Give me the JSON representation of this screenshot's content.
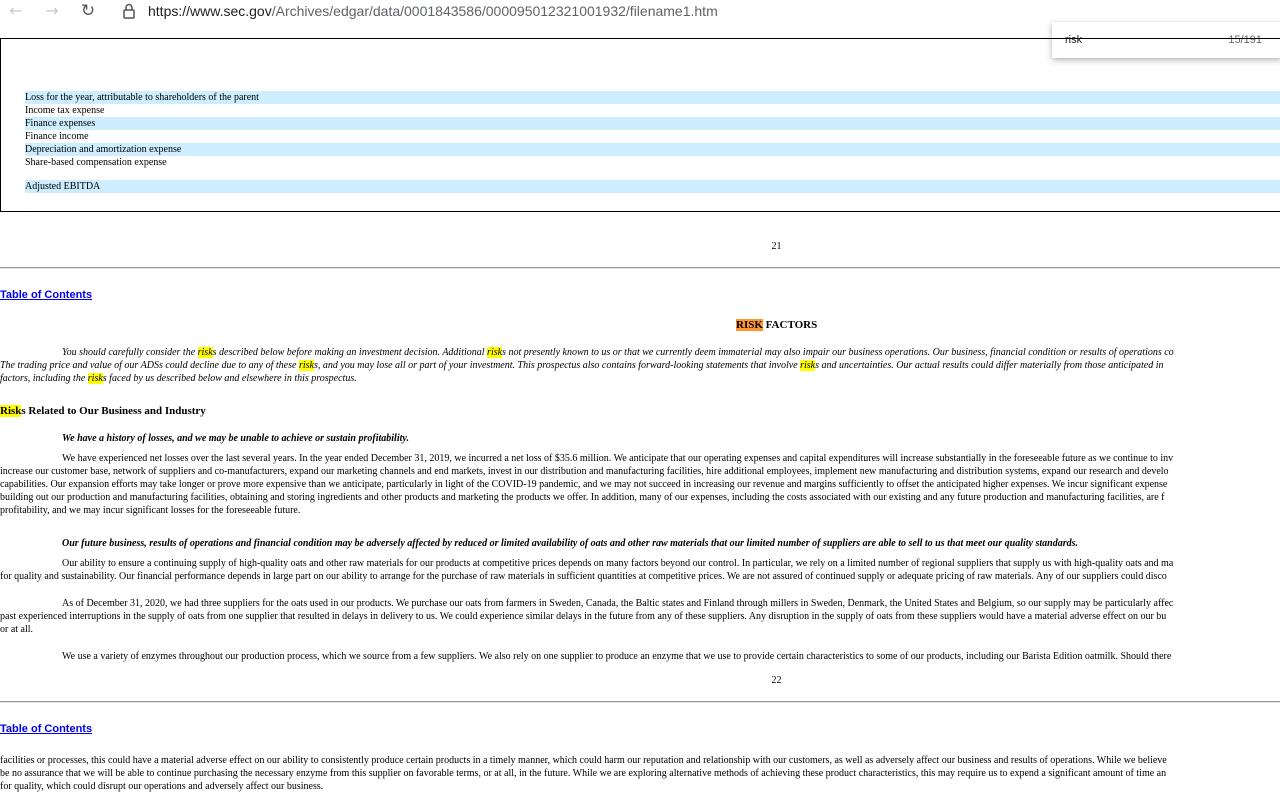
{
  "browser": {
    "url_host": "https://www.sec.gov",
    "url_path": "/Archives/edgar/data/0001843586/000095012321001932/filename1.htm",
    "icons": [
      "back-arrow-icon",
      "forward-arrow-icon",
      "reload-icon",
      "lock-icon"
    ]
  },
  "find": {
    "query": "risk",
    "count": "15/191"
  },
  "table_rows": [
    "Loss for the year, attributable to shareholders of the parent",
    "Income tax expense",
    "Finance expenses",
    "Finance income",
    "Depreciation and amortization expense",
    "Share-based compensation expense",
    "Adjusted EBITDA"
  ],
  "page_numbers": [
    "21",
    "22"
  ],
  "toc_label": "Table of Contents",
  "risk_title": {
    "highlight": "RISK",
    "rest": " FACTORS"
  },
  "intro": {
    "l1a": "You should carefully consider the ",
    "l1h1": "risk",
    "l1b": "s described below before making an investment decision. Additional ",
    "l1h2": "risk",
    "l1c": "s not presently known to us or that we currently deem immaterial may also impair our business operations. Our business, financial condition or results of operations co",
    "l2a": "The trading price and value of our ADSs could decline due to any of these ",
    "l2h1": "risk",
    "l2b": "s, and you may lose all or part of your investment. This prospectus also contains forward-looking statements that involve ",
    "l2h2": "risk",
    "l2c": "s and uncertainties. Our actual results could differ materially from those anticipated in",
    "l3a": "factors, including the ",
    "l3h": "risk",
    "l3b": "s faced by us described below and elsewhere in this prospectus."
  },
  "section_heading": {
    "highlight": "Risk",
    "rest": "s Related to Our Business and Industry"
  },
  "heading1": "We have a history of losses, and we may be unable to achieve or sustain profitability.",
  "para1": [
    "We have experienced net losses over the last several years. In the year ended December 31, 2019, we incurred a net loss of $35.6 million. We anticipate that our operating expenses and capital expenditures will increase substantially in the foreseeable future as we continue to inv",
    "increase our customer base, network of suppliers and co-manufacturers, expand our marketing channels and end markets, invest in our distribution and manufacturing facilities, hire additional employees, implement new manufacturing and distribution systems, expand our research and develo",
    "capabilities. Our expansion efforts may take longer or prove more expensive than we anticipate, particularly in light of the COVID-19 pandemic, and we may not succeed in increasing our revenue and margins sufficiently to offset the anticipated higher expenses. We incur significant expense",
    "building out our production and manufacturing facilities, obtaining and storing ingredients and other products and marketing the products we offer. In addition, many of our expenses, including the costs associated with our existing and any future production and manufacturing facilities, are f",
    "profitability, and we may incur significant losses for the foreseeable future."
  ],
  "heading2": "Our future business, results of operations and financial condition may be adversely affected by reduced or limited availability of oats and other raw materials that our limited number of suppliers are able to sell to us that meet our quality standards.",
  "para2": [
    "Our ability to ensure a continuing supply of high-quality oats and other raw materials for our products at competitive prices depends on many factors beyond our control. In particular, we rely on a limited number of regional suppliers that supply us with high-quality oats and ma",
    "for quality and sustainability. Our financial performance depends in large part on our ability to arrange for the purchase of raw materials in sufficient quantities at competitive prices. We are not assured of continued supply or adequate pricing of raw materials. Any of our suppliers could disco"
  ],
  "para3": [
    "As of December 31, 2020, we had three suppliers for the oats used in our products. We purchase our oats from farmers in Sweden, Canada, the Baltic states and Finland through millers in Sweden, Denmark, the United States and Belgium, so our supply may be particularly affec",
    "past experienced interruptions in the supply of oats from one supplier that resulted in delays in delivery to us. We could experience similar delays in the future from any of these suppliers. Any disruption in the supply of oats from these suppliers would have a material adverse effect on our bu",
    "or at all."
  ],
  "para4": [
    "We use a variety of enzymes throughout our production process, which we source from a few suppliers. We also rely on one supplier to produce an enzyme that we use to provide certain characteristics to some of our products, including our Barista Edition oatmilk. Should there"
  ],
  "para5": [
    "facilities or processes, this could have a material adverse effect on our ability to consistently produce certain products in a timely manner, which could harm our reputation and relationship with our customers, as well as adversely affect our business and results of operations. While we believe",
    "be no assurance that we will be able to continue purchasing the necessary enzyme from this supplier on favorable terms, or at all, in the future. While we are exploring alternative methods of achieving these product characteristics, this may require us to expend a significant amount of time an",
    "for quality, which could disrupt our operations and adversely affect our business."
  ]
}
